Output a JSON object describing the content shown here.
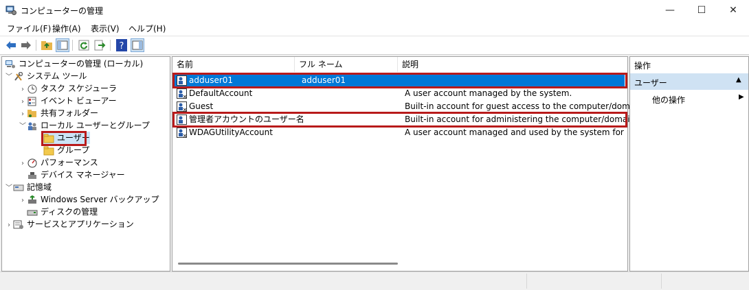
{
  "window": {
    "title": "コンピューターの管理",
    "minimize": "—",
    "maximize": "☐",
    "close": "✕"
  },
  "menu": [
    "ファイル(F)",
    "操作(A)",
    "表示(V)",
    "ヘルプ(H)"
  ],
  "toolbar_icons": [
    "back-arrow-icon",
    "forward-arrow-icon",
    "up-folder-icon",
    "show-hide-tree-icon",
    "refresh-icon",
    "export-list-icon",
    "help-icon",
    "show-action-pane-icon"
  ],
  "tree": {
    "root": "コンピューターの管理 (ローカル)",
    "system_tools": "システム ツール",
    "task_scheduler": "タスク スケジューラ",
    "event_viewer": "イベント ビューアー",
    "shared_folders": "共有フォルダー",
    "local_users_groups": "ローカル ユーザーとグループ",
    "users": "ユーザー",
    "groups": "グループ",
    "performance": "パフォーマンス",
    "device_manager": "デバイス マネージャー",
    "storage": "記憶域",
    "windows_backup": "Windows Server バックアップ",
    "disk_management": "ディスクの管理",
    "services_apps": "サービスとアプリケーション"
  },
  "list": {
    "columns": {
      "name": "名前",
      "fullname": "フル ネーム",
      "description": "説明"
    },
    "rows": [
      {
        "name": "adduser01",
        "fullname": "adduser01",
        "description": ""
      },
      {
        "name": "DefaultAccount",
        "fullname": "",
        "description": "A user account managed by the system."
      },
      {
        "name": "Guest",
        "fullname": "",
        "description": "Built-in account for guest access to the computer/domain"
      },
      {
        "name": "管理者アカウントのユーザー名",
        "fullname": "",
        "description": "Built-in account for administering the computer/domain"
      },
      {
        "name": "WDAGUtilityAccount",
        "fullname": "",
        "description": "A user account managed and used by the system for Windows"
      }
    ]
  },
  "actions": {
    "header": "操作",
    "section": "ユーザー",
    "more": "他の操作"
  },
  "colors": {
    "selection": "#0078d7",
    "highlight_box": "#b81a1a",
    "section_bg": "#cfe2f3"
  }
}
